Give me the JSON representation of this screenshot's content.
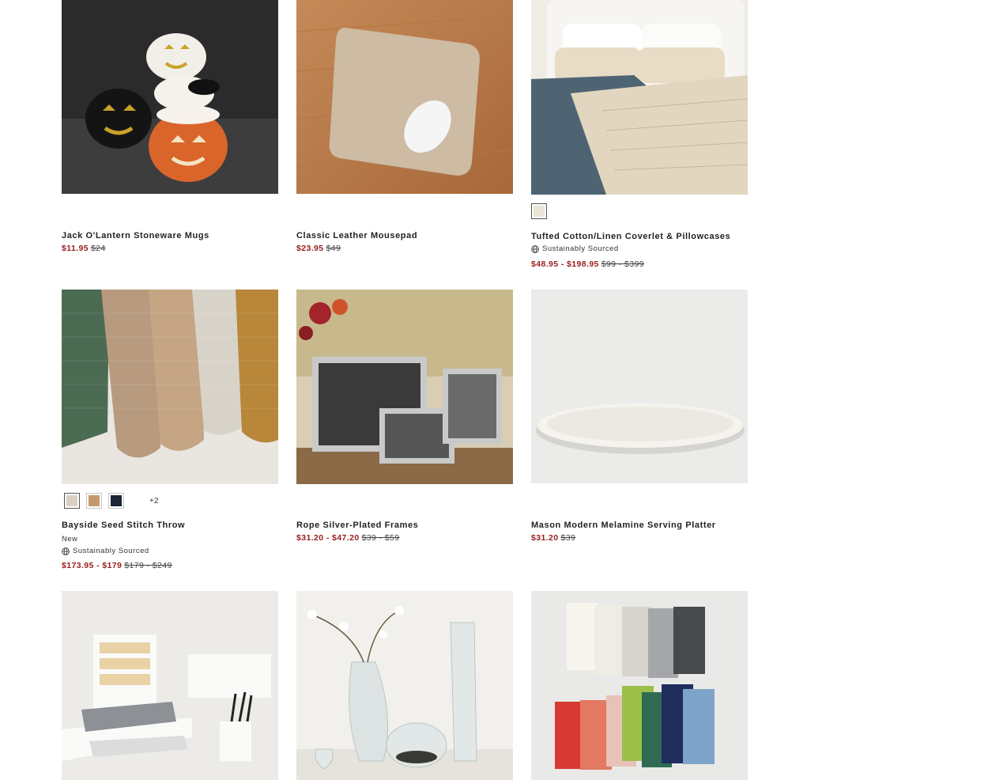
{
  "colors": {
    "sale_price": "#9b1c1c",
    "text": "#222222"
  },
  "products": [
    {
      "title": "Jack O'Lantern Stoneware Mugs",
      "sale_price": "$11.95",
      "original_price": "$24"
    },
    {
      "title": "Classic Leather Mousepad",
      "sale_price": "$23.95",
      "original_price": "$49"
    },
    {
      "title": "Tufted Cotton/Linen Coverlet & Pillowcases",
      "sustainability": "Sustainably Sourced",
      "sale_price": "$48.95 - $198.95",
      "original_price": "$99 - $399"
    },
    {
      "title": "Bayside Seed Stitch Throw",
      "badge": "New",
      "sustainability": "Sustainably Sourced",
      "sale_price": "$173.95 - $179",
      "original_price": "$179 - $249",
      "more_swatches": "+2"
    },
    {
      "title": "Rope Silver-Plated Frames",
      "sale_price": "$31.20 - $47.20",
      "original_price": "$39 - $59"
    },
    {
      "title": "Mason Modern Melamine Serving Platter",
      "sale_price": "$31.20",
      "original_price": "$39"
    },
    {
      "title": ""
    },
    {
      "title": ""
    },
    {
      "title": ""
    }
  ]
}
